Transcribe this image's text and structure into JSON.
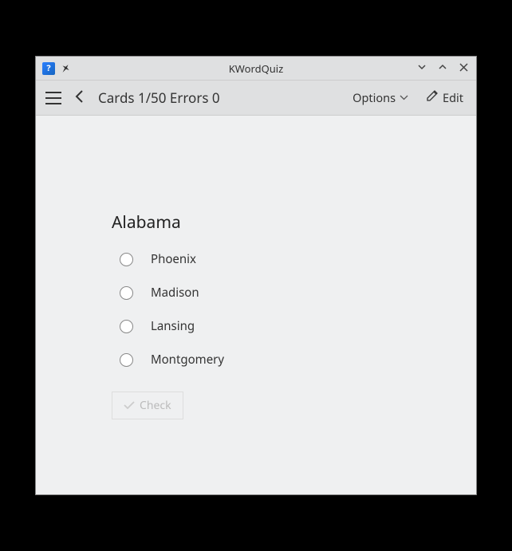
{
  "titlebar": {
    "title": "KWordQuiz"
  },
  "toolbar": {
    "heading": "Cards 1/50 Errors 0",
    "options_label": "Options",
    "edit_label": "Edit"
  },
  "quiz": {
    "question": "Alabama",
    "options": [
      {
        "label": "Phoenix"
      },
      {
        "label": "Madison"
      },
      {
        "label": "Lansing"
      },
      {
        "label": "Montgomery"
      }
    ],
    "check_label": "Check"
  }
}
